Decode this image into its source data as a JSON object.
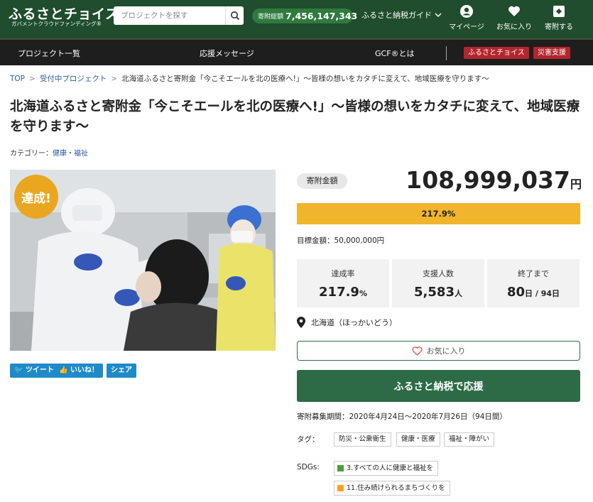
{
  "header": {
    "logo_main": "ふるさとチョイス",
    "logo_sub": "ガバメントクラウドファンディング®",
    "search_placeholder": "プロジェクトを探す",
    "total_label": "寄附総額",
    "total_value": "7,456,147,343",
    "guide_label": "ふるさと納税ガイド",
    "mypage_label": "マイページ",
    "favorites_label": "お気に入り",
    "donate_label": "寄附する"
  },
  "nav": {
    "projects": "プロジェクト一覧",
    "messages": "応援メッセージ",
    "about": "GCF®とは",
    "choice": "ふるさとチョイス",
    "disaster": "災害支援"
  },
  "breadcrumb": {
    "top": "TOP",
    "accepting": "受付中プロジェクト",
    "current": "北海道ふるさと寄附金「今こそエールを北の医療へ!」～皆様の想いをカタチに変えて、地域医療を守ります～"
  },
  "project": {
    "title": "北海道ふるさと寄附金「今こそエールを北の医療へ!」～皆様の想いをカタチに変えて、地域医療を守ります～",
    "category_label": "カテゴリー：",
    "category_value": "健康・福祉",
    "achieved_badge": "達成!"
  },
  "social": {
    "tweet": "ツイート",
    "like": "いいね！",
    "share": "シェア"
  },
  "funding": {
    "amount_label": "寄附金額",
    "amount_value": "108,999,037",
    "amount_unit": "円",
    "progress_text": "217.9%",
    "progress_fraction": 1.0,
    "goal_text": "目標金額：50,000,000円"
  },
  "stats": {
    "rate_label": "達成率",
    "rate_value": "217.9",
    "rate_unit": "%",
    "supporters_label": "支援人数",
    "supporters_value": "5,583",
    "supporters_unit": "人",
    "remaining_label": "終了まで",
    "remaining_value": "80",
    "remaining_unit": "日 / 94日"
  },
  "location": "北海道（ほっかいどう）",
  "actions": {
    "favorite": "お気に入り",
    "donate": "ふるさと納税で応援"
  },
  "period": "寄附募集期間：2020年4月24日～2020年7月26日（94日間）",
  "tags": {
    "label": "タグ：",
    "items": [
      "防災・公衆衛生",
      "健康・医療",
      "福祉・障がい"
    ]
  },
  "sdgs": {
    "label": "SDGs:",
    "items": [
      {
        "text": "3.すべての人に健康と福祉を",
        "color": "#4c9f38"
      },
      {
        "text": "11.住み続けられるまちづくりを",
        "color": "#fd9d24"
      }
    ]
  },
  "colors": {
    "header_green": "#1f4d2d",
    "progress_yellow": "#f0b52d",
    "donate_green": "#2d6b47",
    "badge_orange": "#e9a721",
    "social_blue": "#1f8ac8",
    "nav_red": "#b3262e"
  }
}
